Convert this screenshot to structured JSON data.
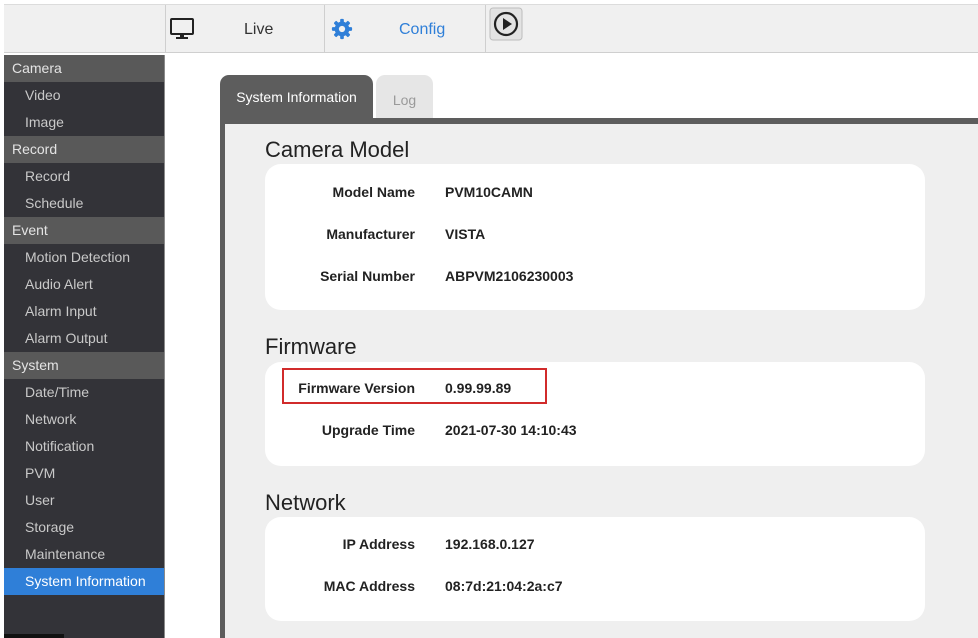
{
  "topbar": {
    "live_label": "Live",
    "config_label": "Config",
    "icons": [
      "monitor-icon",
      "gear-icon",
      "playback-icon"
    ]
  },
  "sidebar": {
    "sections": [
      {
        "label": "Camera",
        "items": [
          "Video",
          "Image"
        ]
      },
      {
        "label": "Record",
        "items": [
          "Record",
          "Schedule"
        ]
      },
      {
        "label": "Event",
        "items": [
          "Motion Detection",
          "Audio Alert",
          "Alarm Input",
          "Alarm Output"
        ]
      },
      {
        "label": "System",
        "items": [
          "Date/Time",
          "Network",
          "Notification",
          "PVM",
          "User",
          "Storage",
          "Maintenance",
          "System Information"
        ]
      }
    ],
    "active_item": "System Information"
  },
  "tabs": {
    "active": "System Information",
    "inactive": "Log"
  },
  "camera_model": {
    "title": "Camera Model",
    "rows": [
      {
        "label": "Model Name",
        "value": "PVM10CAMN"
      },
      {
        "label": "Manufacturer",
        "value": "VISTA"
      },
      {
        "label": "Serial Number",
        "value": "ABPVM2106230003"
      }
    ]
  },
  "firmware": {
    "title": "Firmware",
    "rows": [
      {
        "label": "Firmware Version",
        "value": "0.99.99.89"
      },
      {
        "label": "Upgrade Time",
        "value": "2021-07-30 14:10:43"
      }
    ]
  },
  "network": {
    "title": "Network",
    "rows": [
      {
        "label": "IP Address",
        "value": "192.168.0.127"
      },
      {
        "label": "MAC Address",
        "value": "08:7d:21:04:2a:c7"
      }
    ]
  },
  "colors": {
    "accent": "#2f7fd8",
    "sidebar_bg": "#333338",
    "sidebar_category_bg": "#595959",
    "highlight_border": "#d12b2b"
  }
}
